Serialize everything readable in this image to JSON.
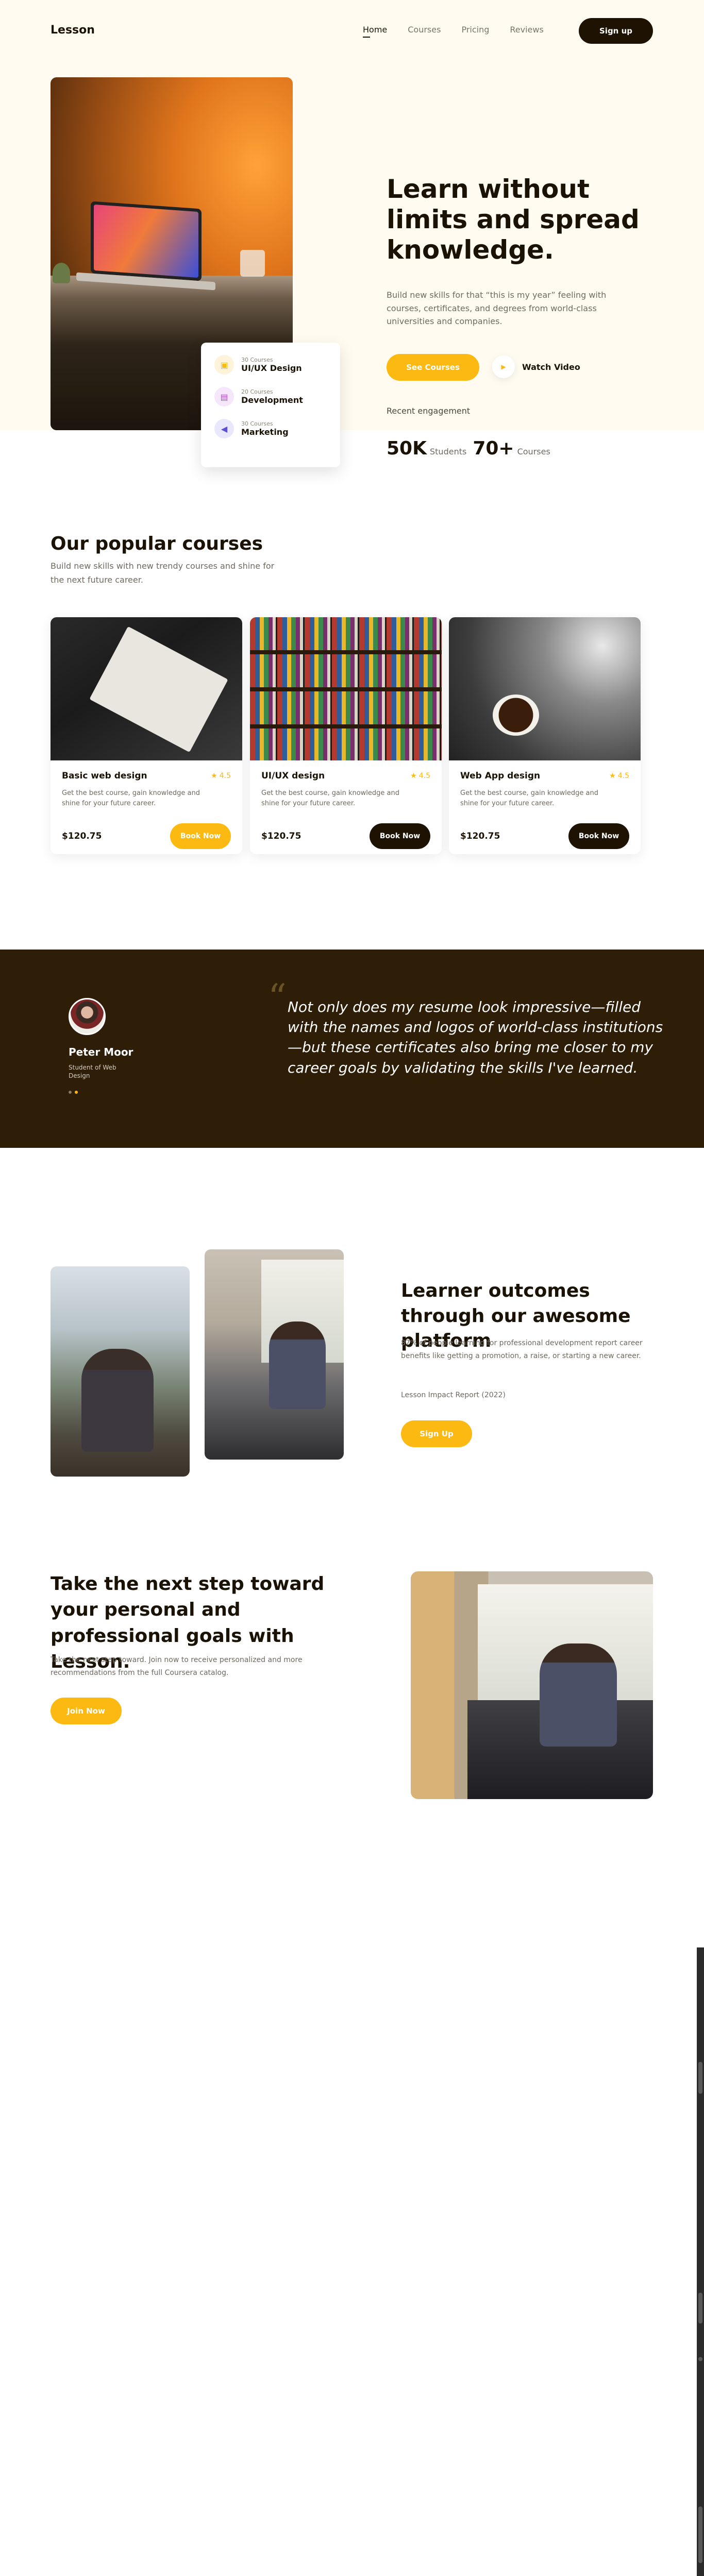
{
  "nav": {
    "logo": "Lesson",
    "links": [
      "Home",
      "Courses",
      "Pricing",
      "Reviews"
    ],
    "signup": "Sign up"
  },
  "hero": {
    "title": "Learn without limits and spread knowledge.",
    "subtitle": "Build new skills for that “this is my year” feeling with courses, certificates, and degrees from world-class universities and companies.",
    "cta": "See Courses",
    "watch": "Watch Video",
    "engagement_label": "Recent engagement",
    "stats": [
      {
        "value": "50K",
        "label": "Students"
      },
      {
        "value": "70+",
        "label": "Courses"
      }
    ],
    "categories": [
      {
        "count": "30 Courses",
        "title": "UI/UX Design",
        "icon": "palette-icon",
        "color": "#fbb912",
        "bg": "#fff4d9"
      },
      {
        "count": "20 Courses",
        "title": "Development",
        "icon": "code-icon",
        "color": "#b44fd6",
        "bg": "#f6e6fb"
      },
      {
        "count": "30 Courses",
        "title": "Marketing",
        "icon": "megaphone-icon",
        "color": "#5a4fd6",
        "bg": "#e9e7fb"
      }
    ]
  },
  "courses": {
    "title": "Our popular courses",
    "subtitle": "Build new skills with new trendy courses and shine for the next future career.",
    "items": [
      {
        "name": "Basic web design",
        "rating": "4.5",
        "desc": "Get the best course, gain knowledge and shine for your future career.",
        "price": "$120.75",
        "button": "Book Now",
        "style": "yellow"
      },
      {
        "name": "UI/UX design",
        "rating": "4.5",
        "desc": "Get the best course, gain knowledge and shine for your future career.",
        "price": "$120.75",
        "button": "Book Now",
        "style": "dark"
      },
      {
        "name": "Web App design",
        "rating": "4.5",
        "desc": "Get the best course, gain knowledge and shine for your future career.",
        "price": "$120.75",
        "button": "Book Now",
        "style": "dark"
      }
    ]
  },
  "testimonial": {
    "name": "Peter Moor",
    "role": "Student of Web Design",
    "quote": "Not only does my resume look impressive—filled with the names and logos of world-class institutions—but these certificates also bring me closer to my career goals by validating the skills I've learned."
  },
  "outcomes": {
    "title": "Learner outcomes through our awesome platform",
    "desc": "87% of people learning for professional development report career benefits like getting a promotion, a raise, or starting a new career.",
    "source": "Lesson Impact Report (2022)",
    "button": "Sign Up"
  },
  "next_step": {
    "title": "Take the next step toward your personal and professional goals with Lesson.",
    "desc": "Take the next step toward. Join now to receive personalized and more recommendations from the full Coursera catalog.",
    "button": "Join Now"
  },
  "colors": {
    "accent": "#fbb912",
    "dark": "#1e1302",
    "testimonial_bg": "#2f1e07",
    "hero_bg": "#fffbf0"
  }
}
